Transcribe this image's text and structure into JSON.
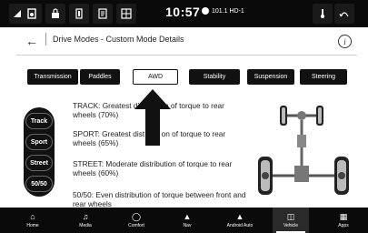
{
  "status_bar": {
    "time": "10:57",
    "radio": "101.1 HD-1",
    "icons": [
      "phone-signal-icon",
      "media-icon",
      "lock-icon",
      "user-icon",
      "lock-status-icon",
      "grid-icon",
      "temperature-icon",
      "recirculation-icon"
    ]
  },
  "header": {
    "back_icon": "back-arrow-icon",
    "title": "Drive Modes - Custom Mode Details",
    "info_icon": "info-icon"
  },
  "tabs": [
    {
      "label": "Transmission"
    },
    {
      "label": "Paddles"
    },
    {
      "label": "AWD"
    },
    {
      "label": "Stability"
    },
    {
      "label": "Suspension"
    },
    {
      "label": "Steering"
    }
  ],
  "active_tab": "AWD",
  "modes": [
    {
      "label": "Track"
    },
    {
      "label": "Sport"
    },
    {
      "label": "Street"
    },
    {
      "label": "50/50"
    }
  ],
  "descriptions": [
    "TRACK: Greatest di          on of torque to rear wheels (70%)",
    "SPORT: Greatest dist        on of torque to rear wheels (65%)",
    "STREET: Moderate distribution of torque to rear wheels (60%)",
    "50/50: Even distribution of torque between front and rear wheels"
  ],
  "nav": [
    {
      "label": "Home",
      "icon": "home-icon"
    },
    {
      "label": "Media",
      "icon": "music-note-icon"
    },
    {
      "label": "Comfort",
      "icon": "comfort-icon"
    },
    {
      "label": "Nav",
      "icon": "navigation-arrow-icon"
    },
    {
      "label": "Android Auto",
      "icon": "android-auto-icon"
    },
    {
      "label": "Vehicle",
      "icon": "vehicle-icon"
    },
    {
      "label": "Apps",
      "icon": "apps-grid-icon"
    }
  ],
  "active_nav": "Vehicle"
}
